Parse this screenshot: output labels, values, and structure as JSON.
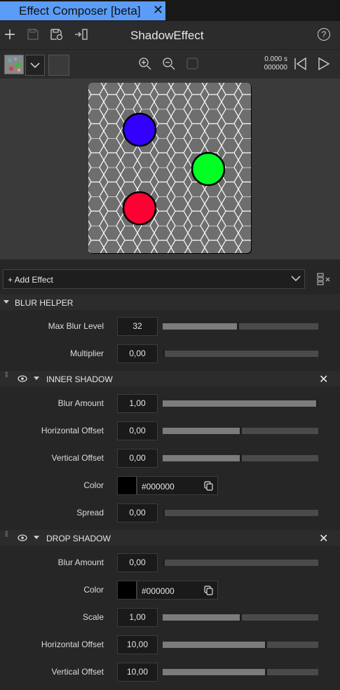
{
  "tab": {
    "title": "Effect Composer [beta]",
    "close": "✕"
  },
  "toolbar": {
    "composition_name": "ShadowEffect",
    "help": "?"
  },
  "timeline": {
    "time": "0.000 s",
    "frame": "000000"
  },
  "add_effect": {
    "label": "+ Add Effect"
  },
  "colors": {
    "accent_tab": "#5b9cf6",
    "panel_bg": "#262626",
    "header_bg": "#2c2c2c"
  },
  "sections": {
    "blur_helper": {
      "title": "BLUR HELPER",
      "max_blur_level": {
        "label": "Max Blur Level",
        "value": "32",
        "slider": 0.48
      },
      "multiplier": {
        "label": "Multiplier",
        "value": "0,00",
        "slider": 0.0
      }
    },
    "inner_shadow": {
      "title": "INNER SHADOW",
      "blur_amount": {
        "label": "Blur Amount",
        "value": "1,00",
        "slider": 1.0
      },
      "horizontal_offset": {
        "label": "Horizontal Offset",
        "value": "0,00",
        "slider": 0.5
      },
      "vertical_offset": {
        "label": "Vertical Offset",
        "value": "0,00",
        "slider": 0.5
      },
      "color": {
        "label": "Color",
        "value": "#000000"
      },
      "spread": {
        "label": "Spread",
        "value": "0,00",
        "slider": 0.0
      }
    },
    "drop_shadow": {
      "title": "DROP SHADOW",
      "blur_amount": {
        "label": "Blur Amount",
        "value": "0,00",
        "slider": 0.0
      },
      "color": {
        "label": "Color",
        "value": "#000000"
      },
      "scale": {
        "label": "Scale",
        "value": "1,00",
        "slider": 0.5
      },
      "horizontal_offset": {
        "label": "Horizontal Offset",
        "value": "10,00",
        "slider": 0.66
      },
      "vertical_offset": {
        "label": "Vertical Offset",
        "value": "10,00",
        "slider": 0.66
      }
    }
  },
  "preview": {
    "circle_colors": [
      "#3300ff",
      "#00ff22",
      "#ff0033"
    ]
  }
}
